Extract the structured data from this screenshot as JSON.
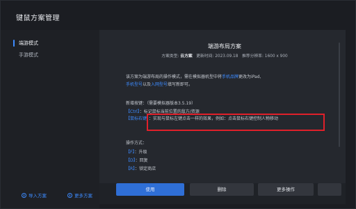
{
  "window": {
    "title": "键鼠方案管理"
  },
  "sidebar": {
    "items": [
      {
        "label": "端游模式",
        "active": true
      },
      {
        "label": "手游模式",
        "active": false
      }
    ],
    "footer": {
      "import_label": "导入方案",
      "more_label": "更多方案"
    }
  },
  "scheme": {
    "title": "端游布局方案",
    "meta": {
      "type_label": "方案类型:",
      "type_value": "云方案",
      "update_label": "更新时间:",
      "update_value": "2023.09.18",
      "res_label": "推荐分辨率:",
      "res_value": "1600 x 900"
    },
    "desc_1": "该方案为端游布局的操作模式，需在模拟器机型中将",
    "desc_link_1": "手机品牌",
    "desc_2": "更改为iPad,",
    "desc_link_2": "手机型号",
    "desc_3": "以及",
    "desc_link_3": "入网型号",
    "desc_4": "填写新即可。",
    "new_keys_label": "新增按键：（需要模拟器版本3.5.19）",
    "ctrl_key": "【Ctrl】",
    "ctrl_text": "：标记鼠标当前位置的敌方/资源",
    "mouse_key": "【鼠标右键】",
    "mouse_text": "：实现与鼠标左键点击一样的效果，例如：点击鼠标右键控制人物移动",
    "ops_label": "操作方式：",
    "ops": [
      {
        "key": "【F】",
        "text": "：升级"
      },
      {
        "key": "【D】",
        "text": "：回复"
      },
      {
        "key": "【R】",
        "text": "：锁定商店"
      }
    ]
  },
  "actions": {
    "apply_label": "使用",
    "delete_label": "删除",
    "more_label": "更多操作"
  },
  "colors": {
    "accent": "#3d8bff",
    "highlight_box": "#e0202a",
    "primary_button": "#2f6fd6"
  }
}
